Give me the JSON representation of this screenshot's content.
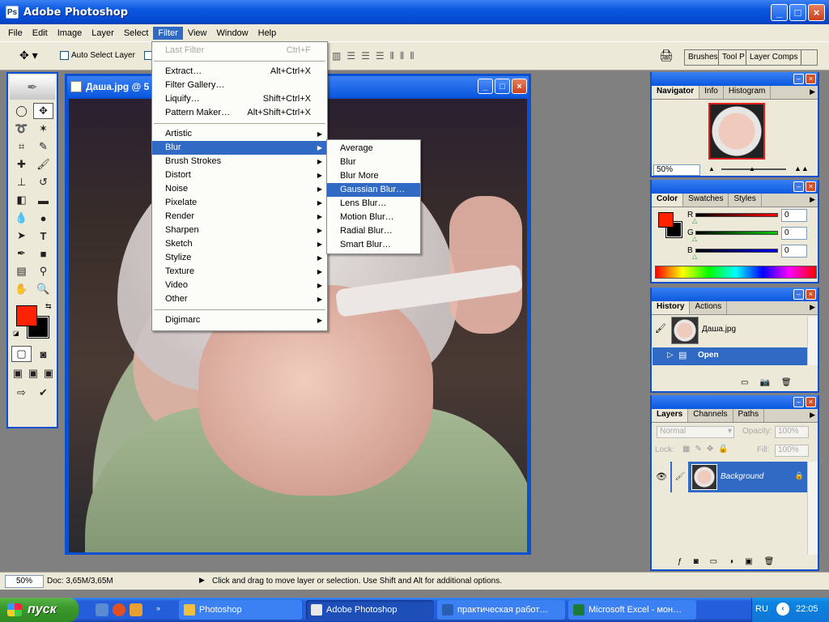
{
  "app": {
    "title": "Adobe Photoshop",
    "min": "_",
    "max": "□",
    "close": "×"
  },
  "menubar": [
    "File",
    "Edit",
    "Image",
    "Layer",
    "Select",
    "Filter",
    "View",
    "Window",
    "Help"
  ],
  "options": {
    "auto_select": "Auto Select Layer"
  },
  "palette_well": [
    "Brushes",
    "Tool P",
    "Layer Comps"
  ],
  "document": {
    "title": "Даша.jpg @ 5"
  },
  "filter_menu": {
    "last_filter": {
      "label": "Last Filter",
      "shortcut": "Ctrl+F"
    },
    "group1": [
      {
        "label": "Extract…",
        "shortcut": "Alt+Ctrl+X"
      },
      {
        "label": "Filter Gallery…",
        "shortcut": ""
      },
      {
        "label": "Liquify…",
        "shortcut": "Shift+Ctrl+X"
      },
      {
        "label": "Pattern Maker…",
        "shortcut": "Alt+Shift+Ctrl+X"
      }
    ],
    "group2": [
      "Artistic",
      "Blur",
      "Brush Strokes",
      "Distort",
      "Noise",
      "Pixelate",
      "Render",
      "Sharpen",
      "Sketch",
      "Stylize",
      "Texture",
      "Video",
      "Other"
    ],
    "group3": [
      "Digimarc"
    ],
    "highlighted": "Blur"
  },
  "blur_menu": {
    "items": [
      "Average",
      "Blur",
      "Blur More",
      "Gaussian Blur…",
      "Lens Blur…",
      "Motion Blur…",
      "Radial Blur…",
      "Smart Blur…"
    ],
    "highlighted": "Gaussian Blur…"
  },
  "navigator": {
    "tabs": [
      "Navigator",
      "Info",
      "Histogram"
    ],
    "zoom": "50%"
  },
  "color": {
    "tabs": [
      "Color",
      "Swatches",
      "Styles"
    ],
    "channels": [
      {
        "label": "R",
        "value": "0"
      },
      {
        "label": "G",
        "value": "0"
      },
      {
        "label": "B",
        "value": "0"
      }
    ],
    "fg": "#ff2200",
    "bg": "#000000"
  },
  "history": {
    "tabs": [
      "History",
      "Actions"
    ],
    "snapshot": "Даша.jpg",
    "state": "Open"
  },
  "layers": {
    "tabs": [
      "Layers",
      "Channels",
      "Paths"
    ],
    "blend": "Normal",
    "opacity_label": "Opacity:",
    "opacity": "100%",
    "lock_label": "Lock:",
    "fill_label": "Fill:",
    "fill": "100%",
    "layer_name": "Background"
  },
  "status": {
    "zoom": "50%",
    "doc": "Doc: 3,65M/3,65M",
    "hint": "Click and drag to move layer or selection.  Use Shift and Alt for additional options."
  },
  "taskbar": {
    "start": "пуск",
    "tasks": [
      {
        "label": "Photoshop",
        "icon_color": "#f0c040"
      },
      {
        "label": "Adobe Photoshop",
        "icon_color": "#e8e8e8"
      },
      {
        "label": "практическая работ…",
        "icon_color": "#2b5fb4"
      },
      {
        "label": "Microsoft Excel - мон…",
        "icon_color": "#1d7a3a"
      }
    ],
    "lang": "RU",
    "clock": "22:05"
  }
}
